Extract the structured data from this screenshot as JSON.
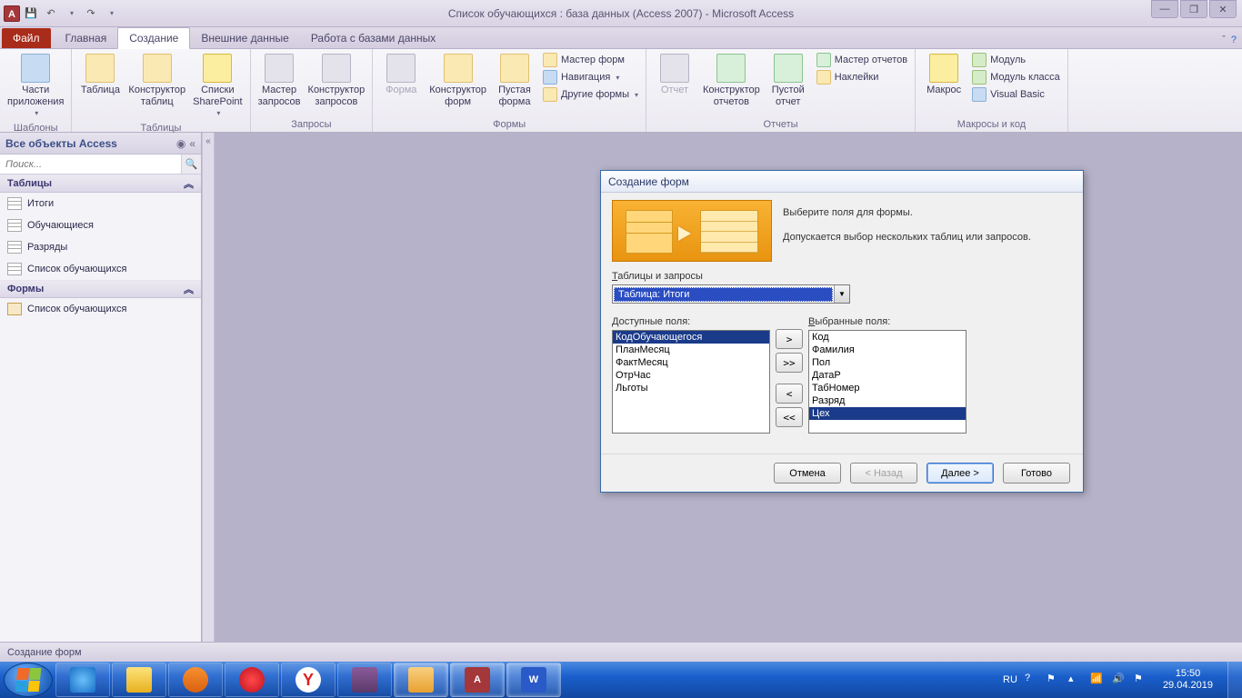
{
  "titlebar": {
    "title": "Список обучающихся : база данных (Access 2007)  -  Microsoft Access"
  },
  "tabs": {
    "file": "Файл",
    "home": "Главная",
    "create": "Создание",
    "external": "Внешние данные",
    "dbtools": "Работа с базами данных"
  },
  "ribbon": {
    "groups": {
      "templates": "Шаблоны",
      "tables": "Таблицы",
      "queries": "Запросы",
      "forms": "Формы",
      "reports": "Отчеты",
      "macros": "Макросы и код"
    },
    "btns": {
      "app_parts": "Части\nприложения",
      "table": "Таблица",
      "table_design": "Конструктор\nтаблиц",
      "sharepoint": "Списки\nSharePoint",
      "query_wiz": "Мастер\nзапросов",
      "query_design": "Конструктор\nзапросов",
      "form": "Форма",
      "form_design": "Конструктор\nформ",
      "blank_form": "Пустая\nформа",
      "form_wizard": "Мастер форм",
      "navigation": "Навигация",
      "other_forms": "Другие формы",
      "report": "Отчет",
      "report_design": "Конструктор\nотчетов",
      "blank_report": "Пустой\nотчет",
      "report_wizard": "Мастер отчетов",
      "labels": "Наклейки",
      "macro": "Макрос",
      "module": "Модуль",
      "class_module": "Модуль класса",
      "visual_basic": "Visual Basic"
    }
  },
  "nav": {
    "header": "Все объекты Access",
    "search_placeholder": "Поиск...",
    "cat_tables": "Таблицы",
    "cat_forms": "Формы",
    "tables": [
      "Итоги",
      "Обучающиеся",
      "Разряды",
      "Список обучающихся"
    ],
    "forms": [
      "Список обучающихся"
    ]
  },
  "dialog": {
    "title": "Создание форм",
    "line1": "Выберите поля для формы.",
    "line2": "Допускается выбор нескольких таблиц или запросов.",
    "tables_label": "Таблицы и запросы",
    "combo_value": "Таблица: Итоги",
    "available_label": "Доступные поля:",
    "selected_label": "Выбранные поля:",
    "available": [
      "КодОбучающегося",
      "ПланМесяц",
      "ФактМесяц",
      "ОтрЧас",
      "Льготы"
    ],
    "selected": [
      "Код",
      "Фамилия",
      "Пол",
      "ДатаР",
      "ТабНомер",
      "Разряд",
      "Цех"
    ],
    "mv": {
      "add": ">",
      "addall": ">>",
      "remove": "<",
      "removeall": "<<"
    },
    "buttons": {
      "cancel": "Отмена",
      "back": "< Назад",
      "next": "Далее >",
      "finish": "Готово"
    }
  },
  "status": "Создание форм",
  "tray": {
    "lang": "RU",
    "time": "15:50",
    "date": "29.04.2019"
  }
}
